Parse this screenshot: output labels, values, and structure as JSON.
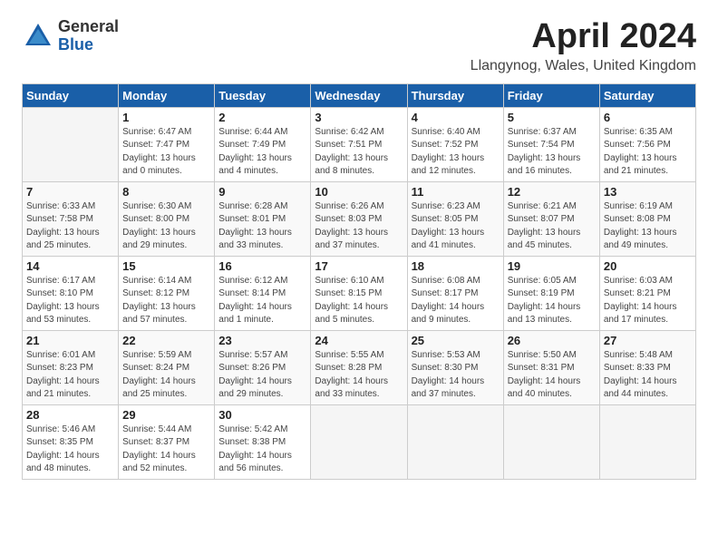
{
  "logo": {
    "general": "General",
    "blue": "Blue"
  },
  "calendar": {
    "title": "April 2024",
    "location": "Llangynog, Wales, United Kingdom",
    "days_of_week": [
      "Sunday",
      "Monday",
      "Tuesday",
      "Wednesday",
      "Thursday",
      "Friday",
      "Saturday"
    ],
    "weeks": [
      [
        {
          "day": "",
          "sunrise": "",
          "sunset": "",
          "daylight": ""
        },
        {
          "day": "1",
          "sunrise": "Sunrise: 6:47 AM",
          "sunset": "Sunset: 7:47 PM",
          "daylight": "Daylight: 13 hours and 0 minutes."
        },
        {
          "day": "2",
          "sunrise": "Sunrise: 6:44 AM",
          "sunset": "Sunset: 7:49 PM",
          "daylight": "Daylight: 13 hours and 4 minutes."
        },
        {
          "day": "3",
          "sunrise": "Sunrise: 6:42 AM",
          "sunset": "Sunset: 7:51 PM",
          "daylight": "Daylight: 13 hours and 8 minutes."
        },
        {
          "day": "4",
          "sunrise": "Sunrise: 6:40 AM",
          "sunset": "Sunset: 7:52 PM",
          "daylight": "Daylight: 13 hours and 12 minutes."
        },
        {
          "day": "5",
          "sunrise": "Sunrise: 6:37 AM",
          "sunset": "Sunset: 7:54 PM",
          "daylight": "Daylight: 13 hours and 16 minutes."
        },
        {
          "day": "6",
          "sunrise": "Sunrise: 6:35 AM",
          "sunset": "Sunset: 7:56 PM",
          "daylight": "Daylight: 13 hours and 21 minutes."
        }
      ],
      [
        {
          "day": "7",
          "sunrise": "Sunrise: 6:33 AM",
          "sunset": "Sunset: 7:58 PM",
          "daylight": "Daylight: 13 hours and 25 minutes."
        },
        {
          "day": "8",
          "sunrise": "Sunrise: 6:30 AM",
          "sunset": "Sunset: 8:00 PM",
          "daylight": "Daylight: 13 hours and 29 minutes."
        },
        {
          "day": "9",
          "sunrise": "Sunrise: 6:28 AM",
          "sunset": "Sunset: 8:01 PM",
          "daylight": "Daylight: 13 hours and 33 minutes."
        },
        {
          "day": "10",
          "sunrise": "Sunrise: 6:26 AM",
          "sunset": "Sunset: 8:03 PM",
          "daylight": "Daylight: 13 hours and 37 minutes."
        },
        {
          "day": "11",
          "sunrise": "Sunrise: 6:23 AM",
          "sunset": "Sunset: 8:05 PM",
          "daylight": "Daylight: 13 hours and 41 minutes."
        },
        {
          "day": "12",
          "sunrise": "Sunrise: 6:21 AM",
          "sunset": "Sunset: 8:07 PM",
          "daylight": "Daylight: 13 hours and 45 minutes."
        },
        {
          "day": "13",
          "sunrise": "Sunrise: 6:19 AM",
          "sunset": "Sunset: 8:08 PM",
          "daylight": "Daylight: 13 hours and 49 minutes."
        }
      ],
      [
        {
          "day": "14",
          "sunrise": "Sunrise: 6:17 AM",
          "sunset": "Sunset: 8:10 PM",
          "daylight": "Daylight: 13 hours and 53 minutes."
        },
        {
          "day": "15",
          "sunrise": "Sunrise: 6:14 AM",
          "sunset": "Sunset: 8:12 PM",
          "daylight": "Daylight: 13 hours and 57 minutes."
        },
        {
          "day": "16",
          "sunrise": "Sunrise: 6:12 AM",
          "sunset": "Sunset: 8:14 PM",
          "daylight": "Daylight: 14 hours and 1 minute."
        },
        {
          "day": "17",
          "sunrise": "Sunrise: 6:10 AM",
          "sunset": "Sunset: 8:15 PM",
          "daylight": "Daylight: 14 hours and 5 minutes."
        },
        {
          "day": "18",
          "sunrise": "Sunrise: 6:08 AM",
          "sunset": "Sunset: 8:17 PM",
          "daylight": "Daylight: 14 hours and 9 minutes."
        },
        {
          "day": "19",
          "sunrise": "Sunrise: 6:05 AM",
          "sunset": "Sunset: 8:19 PM",
          "daylight": "Daylight: 14 hours and 13 minutes."
        },
        {
          "day": "20",
          "sunrise": "Sunrise: 6:03 AM",
          "sunset": "Sunset: 8:21 PM",
          "daylight": "Daylight: 14 hours and 17 minutes."
        }
      ],
      [
        {
          "day": "21",
          "sunrise": "Sunrise: 6:01 AM",
          "sunset": "Sunset: 8:23 PM",
          "daylight": "Daylight: 14 hours and 21 minutes."
        },
        {
          "day": "22",
          "sunrise": "Sunrise: 5:59 AM",
          "sunset": "Sunset: 8:24 PM",
          "daylight": "Daylight: 14 hours and 25 minutes."
        },
        {
          "day": "23",
          "sunrise": "Sunrise: 5:57 AM",
          "sunset": "Sunset: 8:26 PM",
          "daylight": "Daylight: 14 hours and 29 minutes."
        },
        {
          "day": "24",
          "sunrise": "Sunrise: 5:55 AM",
          "sunset": "Sunset: 8:28 PM",
          "daylight": "Daylight: 14 hours and 33 minutes."
        },
        {
          "day": "25",
          "sunrise": "Sunrise: 5:53 AM",
          "sunset": "Sunset: 8:30 PM",
          "daylight": "Daylight: 14 hours and 37 minutes."
        },
        {
          "day": "26",
          "sunrise": "Sunrise: 5:50 AM",
          "sunset": "Sunset: 8:31 PM",
          "daylight": "Daylight: 14 hours and 40 minutes."
        },
        {
          "day": "27",
          "sunrise": "Sunrise: 5:48 AM",
          "sunset": "Sunset: 8:33 PM",
          "daylight": "Daylight: 14 hours and 44 minutes."
        }
      ],
      [
        {
          "day": "28",
          "sunrise": "Sunrise: 5:46 AM",
          "sunset": "Sunset: 8:35 PM",
          "daylight": "Daylight: 14 hours and 48 minutes."
        },
        {
          "day": "29",
          "sunrise": "Sunrise: 5:44 AM",
          "sunset": "Sunset: 8:37 PM",
          "daylight": "Daylight: 14 hours and 52 minutes."
        },
        {
          "day": "30",
          "sunrise": "Sunrise: 5:42 AM",
          "sunset": "Sunset: 8:38 PM",
          "daylight": "Daylight: 14 hours and 56 minutes."
        },
        {
          "day": "",
          "sunrise": "",
          "sunset": "",
          "daylight": ""
        },
        {
          "day": "",
          "sunrise": "",
          "sunset": "",
          "daylight": ""
        },
        {
          "day": "",
          "sunrise": "",
          "sunset": "",
          "daylight": ""
        },
        {
          "day": "",
          "sunrise": "",
          "sunset": "",
          "daylight": ""
        }
      ]
    ]
  }
}
